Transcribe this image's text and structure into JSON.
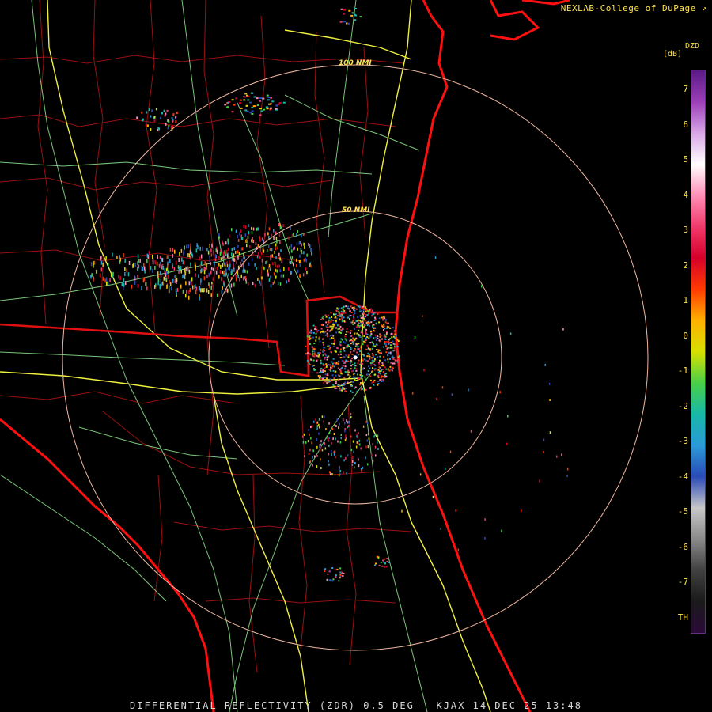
{
  "credit": "NEXLAB-College of DuPage",
  "footer": "DIFFERENTIAL REFLECTIVITY (ZDR) 0.5 DEG - KJAX 14 DEC 25 13:48",
  "range_rings": {
    "ring_50": "50 NMI",
    "ring_100": "100 NMI"
  },
  "colorbar": {
    "product": "DZD",
    "unit": "[dB]",
    "ticks": [
      "7",
      "6",
      "5",
      "4",
      "3",
      "2",
      "1",
      "0",
      "-1",
      "-2",
      "-3",
      "-4",
      "-5",
      "-6",
      "-7",
      "TH"
    ],
    "gradient": [
      "#5a1a86",
      "#9b3fb8",
      "#d7a6e6",
      "#ffffff",
      "#ff8fb8",
      "#f03a6a",
      "#d4002a",
      "#ff3a00",
      "#ffb000",
      "#d8e000",
      "#48d048",
      "#18b8a8",
      "#2a9ad8",
      "#2a4ab8",
      "#c8c8c8",
      "#8a8a8a",
      "#404040",
      "#1a1a1a",
      "#2a0a38"
    ]
  },
  "colors": {
    "coast": "#ff1010",
    "state_line": "#e01010",
    "county": "#9a1010",
    "highway": "#f0f040",
    "road": "#90e890",
    "ring": "#f0b8a0"
  }
}
